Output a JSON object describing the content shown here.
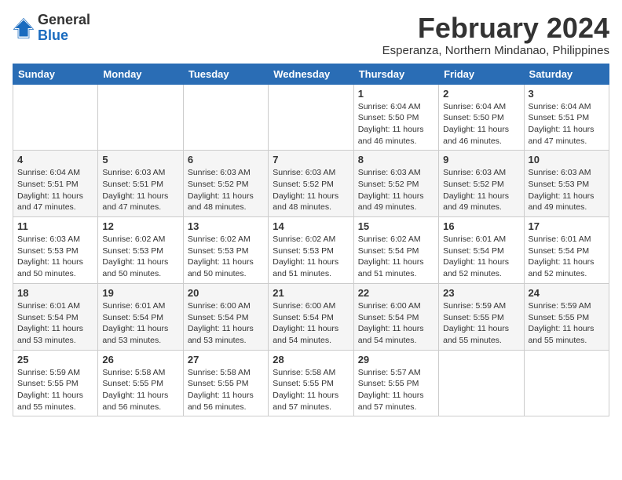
{
  "header": {
    "logo_general": "General",
    "logo_blue": "Blue",
    "title": "February 2024",
    "subtitle": "Esperanza, Northern Mindanao, Philippines"
  },
  "weekdays": [
    "Sunday",
    "Monday",
    "Tuesday",
    "Wednesday",
    "Thursday",
    "Friday",
    "Saturday"
  ],
  "weeks": [
    [
      {
        "day": "",
        "info": ""
      },
      {
        "day": "",
        "info": ""
      },
      {
        "day": "",
        "info": ""
      },
      {
        "day": "",
        "info": ""
      },
      {
        "day": "1",
        "info": "Sunrise: 6:04 AM\nSunset: 5:50 PM\nDaylight: 11 hours and 46 minutes."
      },
      {
        "day": "2",
        "info": "Sunrise: 6:04 AM\nSunset: 5:50 PM\nDaylight: 11 hours and 46 minutes."
      },
      {
        "day": "3",
        "info": "Sunrise: 6:04 AM\nSunset: 5:51 PM\nDaylight: 11 hours and 47 minutes."
      }
    ],
    [
      {
        "day": "4",
        "info": "Sunrise: 6:04 AM\nSunset: 5:51 PM\nDaylight: 11 hours and 47 minutes."
      },
      {
        "day": "5",
        "info": "Sunrise: 6:03 AM\nSunset: 5:51 PM\nDaylight: 11 hours and 47 minutes."
      },
      {
        "day": "6",
        "info": "Sunrise: 6:03 AM\nSunset: 5:52 PM\nDaylight: 11 hours and 48 minutes."
      },
      {
        "day": "7",
        "info": "Sunrise: 6:03 AM\nSunset: 5:52 PM\nDaylight: 11 hours and 48 minutes."
      },
      {
        "day": "8",
        "info": "Sunrise: 6:03 AM\nSunset: 5:52 PM\nDaylight: 11 hours and 49 minutes."
      },
      {
        "day": "9",
        "info": "Sunrise: 6:03 AM\nSunset: 5:52 PM\nDaylight: 11 hours and 49 minutes."
      },
      {
        "day": "10",
        "info": "Sunrise: 6:03 AM\nSunset: 5:53 PM\nDaylight: 11 hours and 49 minutes."
      }
    ],
    [
      {
        "day": "11",
        "info": "Sunrise: 6:03 AM\nSunset: 5:53 PM\nDaylight: 11 hours and 50 minutes."
      },
      {
        "day": "12",
        "info": "Sunrise: 6:02 AM\nSunset: 5:53 PM\nDaylight: 11 hours and 50 minutes."
      },
      {
        "day": "13",
        "info": "Sunrise: 6:02 AM\nSunset: 5:53 PM\nDaylight: 11 hours and 50 minutes."
      },
      {
        "day": "14",
        "info": "Sunrise: 6:02 AM\nSunset: 5:53 PM\nDaylight: 11 hours and 51 minutes."
      },
      {
        "day": "15",
        "info": "Sunrise: 6:02 AM\nSunset: 5:54 PM\nDaylight: 11 hours and 51 minutes."
      },
      {
        "day": "16",
        "info": "Sunrise: 6:01 AM\nSunset: 5:54 PM\nDaylight: 11 hours and 52 minutes."
      },
      {
        "day": "17",
        "info": "Sunrise: 6:01 AM\nSunset: 5:54 PM\nDaylight: 11 hours and 52 minutes."
      }
    ],
    [
      {
        "day": "18",
        "info": "Sunrise: 6:01 AM\nSunset: 5:54 PM\nDaylight: 11 hours and 53 minutes."
      },
      {
        "day": "19",
        "info": "Sunrise: 6:01 AM\nSunset: 5:54 PM\nDaylight: 11 hours and 53 minutes."
      },
      {
        "day": "20",
        "info": "Sunrise: 6:00 AM\nSunset: 5:54 PM\nDaylight: 11 hours and 53 minutes."
      },
      {
        "day": "21",
        "info": "Sunrise: 6:00 AM\nSunset: 5:54 PM\nDaylight: 11 hours and 54 minutes."
      },
      {
        "day": "22",
        "info": "Sunrise: 6:00 AM\nSunset: 5:54 PM\nDaylight: 11 hours and 54 minutes."
      },
      {
        "day": "23",
        "info": "Sunrise: 5:59 AM\nSunset: 5:55 PM\nDaylight: 11 hours and 55 minutes."
      },
      {
        "day": "24",
        "info": "Sunrise: 5:59 AM\nSunset: 5:55 PM\nDaylight: 11 hours and 55 minutes."
      }
    ],
    [
      {
        "day": "25",
        "info": "Sunrise: 5:59 AM\nSunset: 5:55 PM\nDaylight: 11 hours and 55 minutes."
      },
      {
        "day": "26",
        "info": "Sunrise: 5:58 AM\nSunset: 5:55 PM\nDaylight: 11 hours and 56 minutes."
      },
      {
        "day": "27",
        "info": "Sunrise: 5:58 AM\nSunset: 5:55 PM\nDaylight: 11 hours and 56 minutes."
      },
      {
        "day": "28",
        "info": "Sunrise: 5:58 AM\nSunset: 5:55 PM\nDaylight: 11 hours and 57 minutes."
      },
      {
        "day": "29",
        "info": "Sunrise: 5:57 AM\nSunset: 5:55 PM\nDaylight: 11 hours and 57 minutes."
      },
      {
        "day": "",
        "info": ""
      },
      {
        "day": "",
        "info": ""
      }
    ]
  ]
}
